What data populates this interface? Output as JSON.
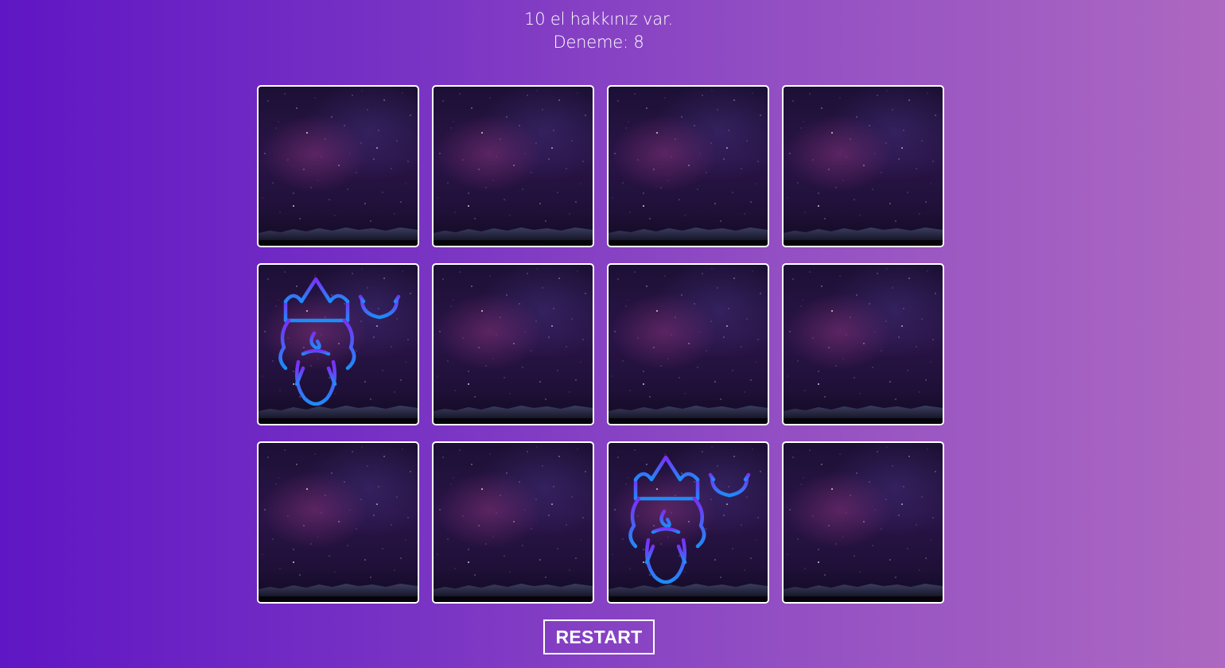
{
  "status": {
    "attempts_left_text": "10 el hakkınız var.",
    "tries_label": "Deneme: 8"
  },
  "board": {
    "rows": 3,
    "columns": 4,
    "cards": [
      {
        "state": "hidden"
      },
      {
        "state": "hidden"
      },
      {
        "state": "hidden"
      },
      {
        "state": "hidden"
      },
      {
        "state": "revealed",
        "icon": "poseidon-icon"
      },
      {
        "state": "hidden"
      },
      {
        "state": "hidden"
      },
      {
        "state": "hidden"
      },
      {
        "state": "hidden"
      },
      {
        "state": "hidden"
      },
      {
        "state": "revealed",
        "icon": "poseidon-icon"
      },
      {
        "state": "hidden"
      }
    ]
  },
  "controls": {
    "restart_label": "RESTART"
  },
  "colors": {
    "background_start": "#5f16c4",
    "background_end": "#ad68c1",
    "card_border": "#ffffff",
    "icon_gradient_top": "#7b2ff7",
    "icon_gradient_bottom": "#1d8cf8"
  }
}
